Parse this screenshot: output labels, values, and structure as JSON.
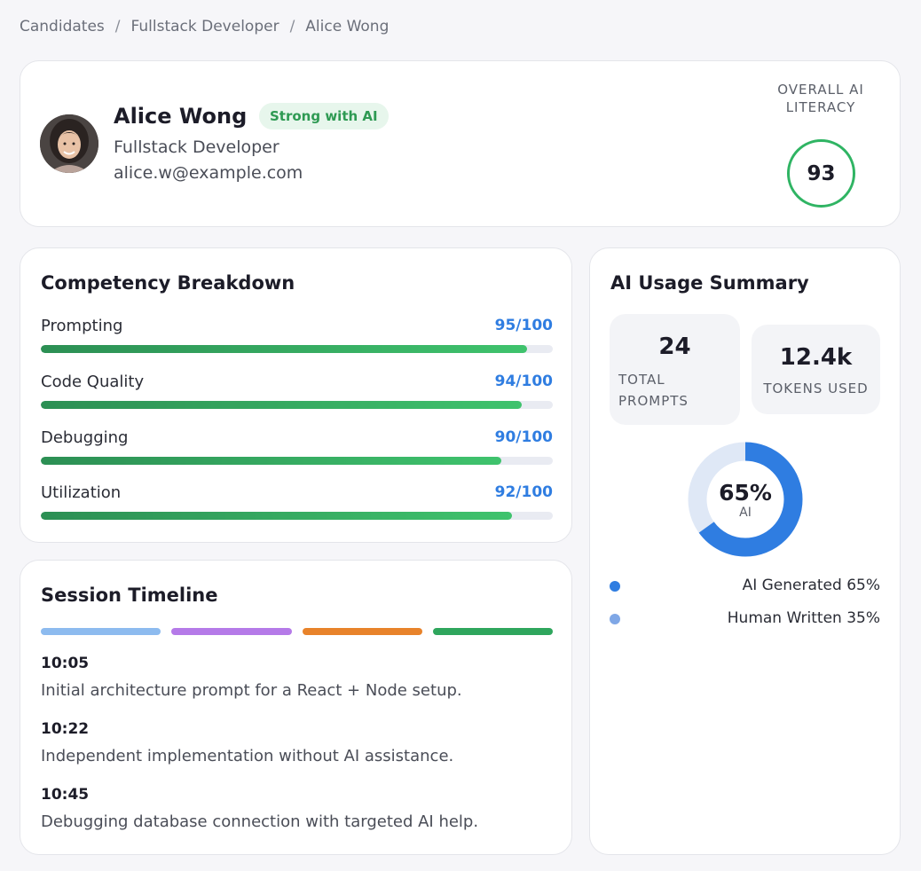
{
  "breadcrumb": [
    "Candidates",
    "Fullstack Developer",
    "Alice Wong"
  ],
  "candidate": {
    "name": "Alice Wong",
    "badge": "Strong with AI",
    "role": "Fullstack Developer",
    "email": "alice.w@example.com"
  },
  "literacy": {
    "label": "OVERALL AI LITERACY",
    "score": "93"
  },
  "competency": {
    "title": "Competency Breakdown",
    "items": [
      {
        "label": "Prompting",
        "score": "95/100",
        "value": 95
      },
      {
        "label": "Code Quality",
        "score": "94/100",
        "value": 94
      },
      {
        "label": "Debugging",
        "score": "90/100",
        "value": 90
      },
      {
        "label": "Utilization",
        "score": "92/100",
        "value": 92
      }
    ]
  },
  "timeline": {
    "title": "Session Timeline",
    "segment_colors": [
      "#8dbbef",
      "#b57ae8",
      "#e8832b",
      "#2fa65d"
    ],
    "events": [
      {
        "time": "10:05",
        "text": "Initial architecture prompt for a React + Node setup."
      },
      {
        "time": "10:22",
        "text": "Independent implementation without AI assistance."
      },
      {
        "time": "10:45",
        "text": "Debugging database connection with targeted AI help."
      }
    ]
  },
  "usage": {
    "title": "AI Usage Summary",
    "total_prompts": "24",
    "total_prompts_label": "TOTAL PROMPTS",
    "tokens_used": "12.4k",
    "tokens_used_label": "TOKENS USED",
    "donut": {
      "ai_fraction": 0.65,
      "center_value": "65%",
      "center_label": "AI",
      "ai_color": "#2f7de1",
      "human_color": "#dfe8f6"
    },
    "legend": [
      {
        "label": "AI Generated 65%",
        "color": "#2f7de1"
      },
      {
        "label": "Human Written 35%",
        "color": "#7fa7e6"
      }
    ]
  },
  "colors": {
    "accent_blue": "#2f7de1",
    "accent_green": "#2fb463",
    "badge_bg": "#e7f6ec"
  }
}
